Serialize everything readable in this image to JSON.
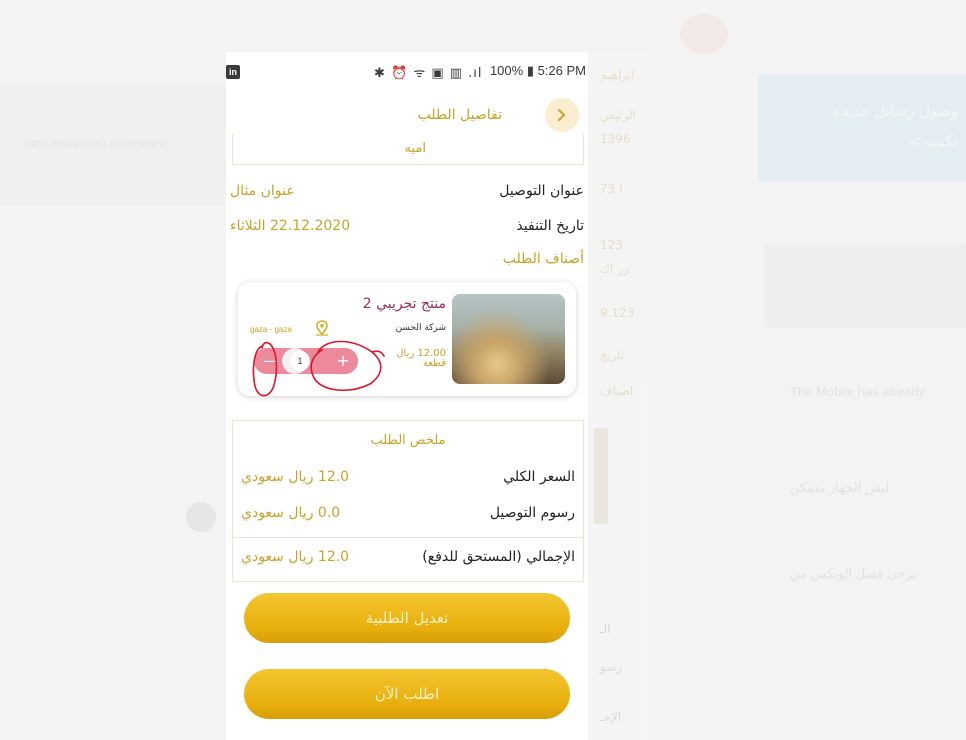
{
  "background": {
    "link_text": "http://dleel360.com/televi",
    "mid_col_texts": [
      "ابراهيم",
      "الرئيس",
      "1396",
      "73 ا",
      "123",
      "زر اك",
      "9.123",
      "تاريخ",
      "اصناف",
      "الـ",
      "رسو",
      "الإجـ"
    ],
    "banner_lines": [
      "وصول رسائل جديدة",
      "< تكيب"
    ],
    "right_texts": [
      "The Mobile has already",
      "ليس الجهاز متمكن",
      "يرجى فصل الويكس من"
    ]
  },
  "status_bar": {
    "linkedin_glyph": "in",
    "icons": "✱ ⏰ ᯤ ▣ ▥ .ıl",
    "battery_time": "100% ▮ 5:26 PM"
  },
  "header": {
    "title": "تفاصيل الطلب",
    "back_icon": "chevron-right-icon"
  },
  "customer": {
    "name": "اميه"
  },
  "details": {
    "address_label": "عنوان التوصيل",
    "address_value": "عنوان مثال",
    "date_label": "تاريخ التنفيذ",
    "date_value": "22.12.2020 الثلاثاء",
    "items_link": "أصناف الطلب"
  },
  "product": {
    "name": "منتج تجريبي 2",
    "company": "شركة الحسن",
    "location": "gaza - gaza",
    "price_line1": "12.00 ريال",
    "price_line2": "قطعة",
    "quantity": "1",
    "minus_label": "—",
    "plus_label": "+"
  },
  "summary": {
    "title": "ملخص الطلب",
    "rows": [
      {
        "label": "السعر الكلي",
        "value": "12.0 ريال سعودي"
      },
      {
        "label": "رسوم التوصيل",
        "value": "0.0 ريال سعودي"
      }
    ],
    "total_label": "الإجمالي (المستحق للدفع)",
    "total_value": "12.0 ريال سعودي"
  },
  "buttons": {
    "edit": "تعديل الطلبية",
    "order_now": "اطلب الآن"
  },
  "colors": {
    "accent_gold": "#c9a227",
    "button_gold": "#e8af0c",
    "product_name": "#9c2a5e",
    "stepper_pink": "#ec8a9c",
    "annotation_red": "#e0142a"
  }
}
